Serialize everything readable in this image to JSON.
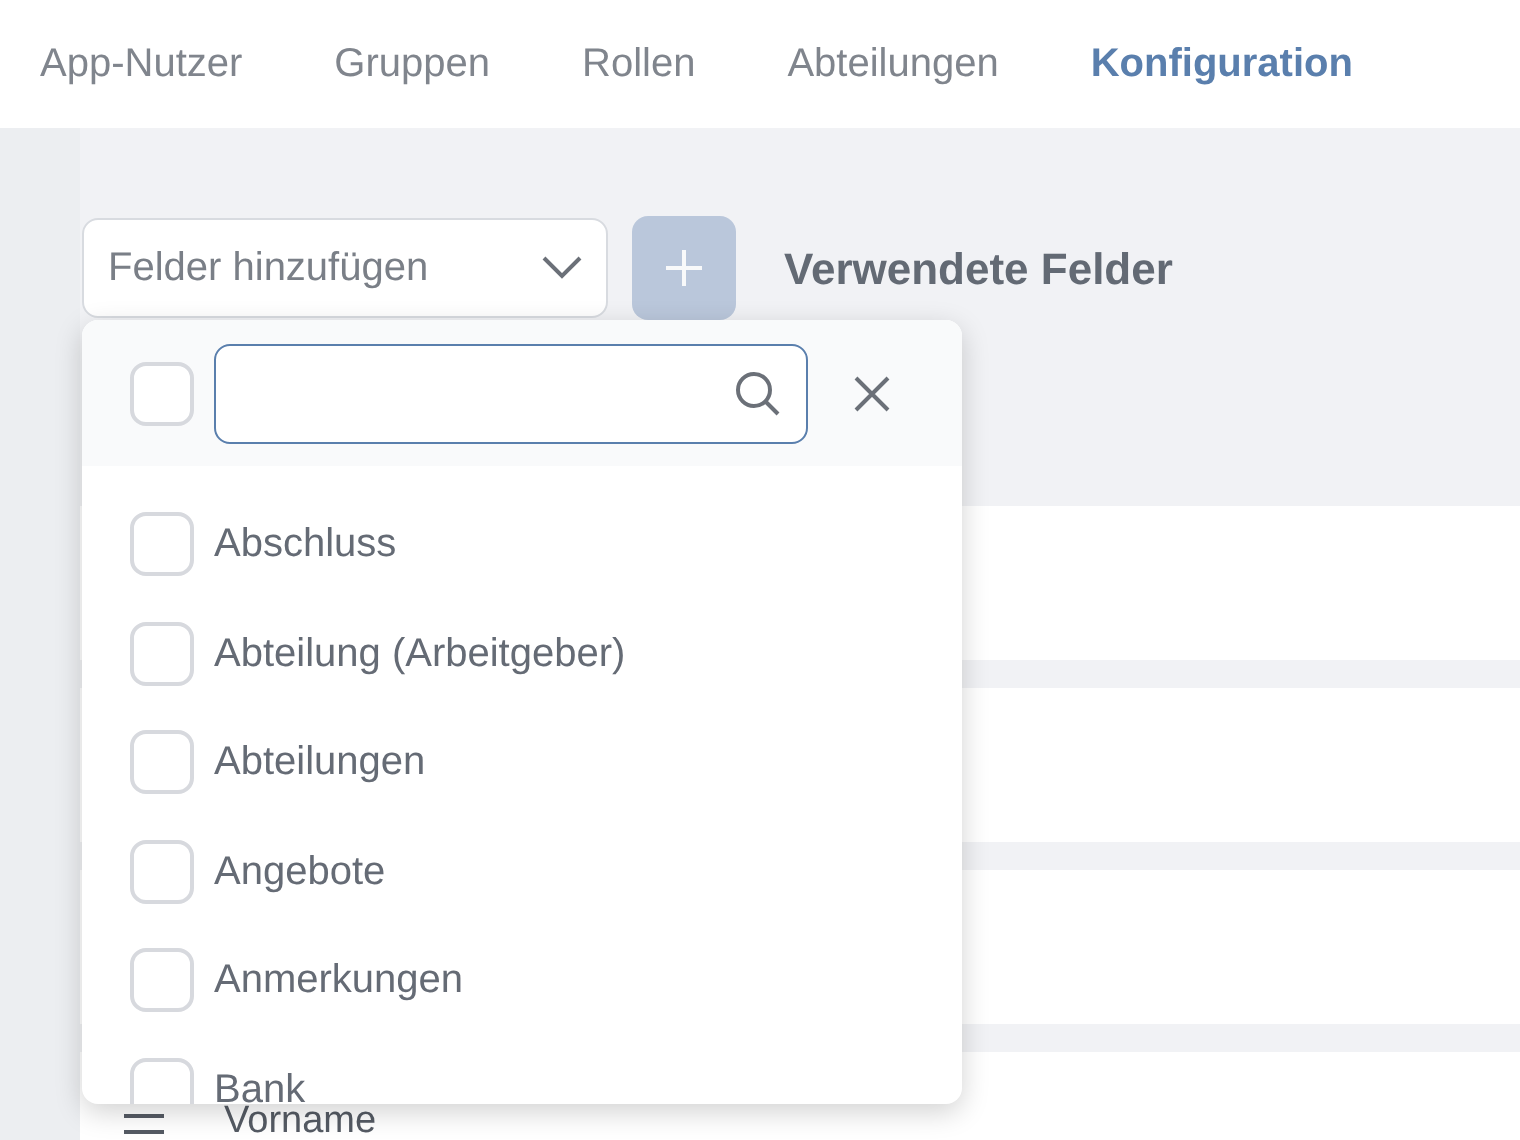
{
  "tabs": [
    {
      "label": "App-Nutzer",
      "selected": false
    },
    {
      "label": "Gruppen",
      "selected": false
    },
    {
      "label": "Rollen",
      "selected": false
    },
    {
      "label": "Abteilungen",
      "selected": false
    },
    {
      "label": "Konfiguration",
      "selected": true
    }
  ],
  "field_select": {
    "placeholder": "Felder hinzufügen"
  },
  "add_button": {
    "disabled": true
  },
  "heading": "Verwendete Felder",
  "used_fields": [
    {
      "kind": "card"
    },
    {
      "kind": "card"
    },
    {
      "kind": "card"
    },
    {
      "kind": "card",
      "label": "Vorname"
    }
  ],
  "dropdown": {
    "select_all_checked": false,
    "options": [
      {
        "label": "Abschluss",
        "checked": false
      },
      {
        "label": "Abteilung (Arbeitgeber)",
        "checked": false
      },
      {
        "label": "Abteilungen",
        "checked": false
      },
      {
        "label": "Angebote",
        "checked": false
      },
      {
        "label": "Anmerkungen",
        "checked": false
      },
      {
        "label": "Bank",
        "checked": false
      }
    ]
  }
}
